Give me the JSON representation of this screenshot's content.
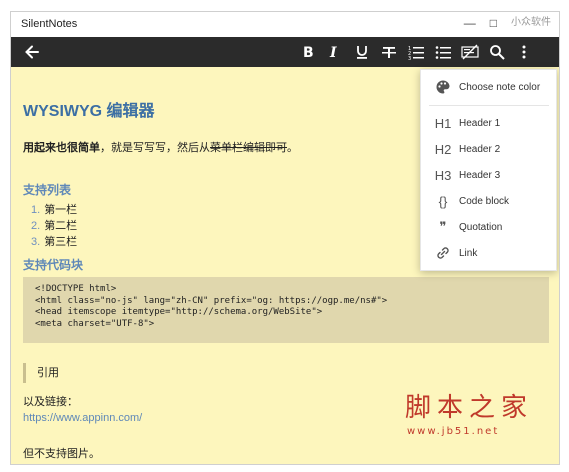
{
  "window": {
    "title": "SilentNotes",
    "minimize": "—",
    "maximize": "□",
    "watermark_top": "小众软件"
  },
  "toolbar": {
    "back": "back-arrow-icon",
    "icons": [
      "bold-icon",
      "italic-icon",
      "underline-icon",
      "strikethrough-icon",
      "numbered-list-icon",
      "bulleted-list-icon",
      "clear-format-icon",
      "search-icon",
      "more-icon"
    ]
  },
  "note": {
    "heading": "WYSIWYG 编辑器",
    "intro_bold": "用起来也很简单",
    "intro_mid": "，就是写写写，然后从",
    "intro_strike": "菜单栏编辑即可",
    "intro_end": "。",
    "list_heading": "支持列表",
    "list": [
      {
        "num": "1.",
        "text": "第一栏"
      },
      {
        "num": "2.",
        "text": "第二栏"
      },
      {
        "num": "3.",
        "text": "第三栏"
      }
    ],
    "code_heading": "支持代码块",
    "code": [
      "<!DOCTYPE html>",
      "<html class=\"no-js\" lang=\"zh-CN\" prefix=\"og: https://ogp.me/ns#\">",
      "<head itemscope itemtype=\"http://schema.org/WebSite\">",
      "<meta charset=\"UTF-8\">"
    ],
    "quote": "引用",
    "link_intro": "以及链接：",
    "link": "https://www.appinn.com/",
    "footer": "但不支持图片。"
  },
  "menu": {
    "items": [
      {
        "label": "Choose note color",
        "icon": "palette-icon"
      },
      {
        "label": "Header 1",
        "icon": "h1-icon",
        "glyph": "H1"
      },
      {
        "label": "Header 2",
        "icon": "h2-icon",
        "glyph": "H2"
      },
      {
        "label": "Header 3",
        "icon": "h3-icon",
        "glyph": "H3"
      },
      {
        "label": "Code block",
        "icon": "code-block-icon",
        "glyph": "{}"
      },
      {
        "label": "Quotation",
        "icon": "quote-icon",
        "glyph": "❞"
      },
      {
        "label": "Link",
        "icon": "link-icon"
      }
    ]
  },
  "watermark": {
    "cn": "脚本之家",
    "url": "www.jb51.net"
  },
  "colors": {
    "toolbar_bg": "#2b2b2b",
    "note_bg": "#fdf6bd",
    "heading": "#3c6fa4",
    "subheading": "#5f88b8",
    "code_bg": "#e0d7ad",
    "watermark": "#c0392b"
  }
}
